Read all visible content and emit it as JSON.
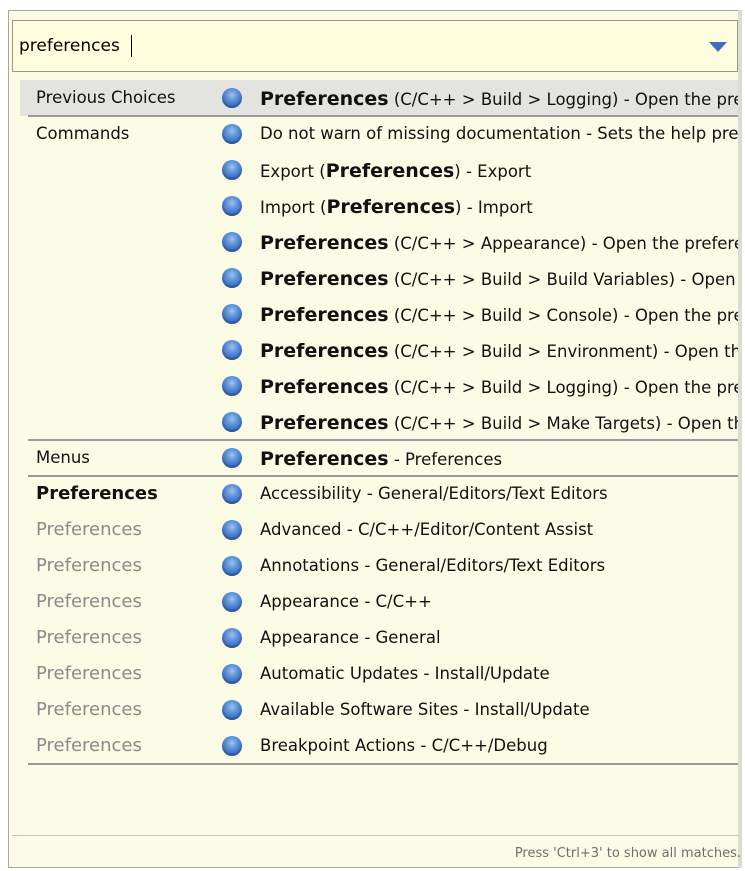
{
  "search": {
    "value": "preferences"
  },
  "rows": [
    {
      "category": "Previous Choices",
      "cat_style": "normal",
      "bold": "Preferences",
      "rest": " (C/C++ > Build > Logging) - Open the preference page",
      "selected": true
    },
    {
      "category": "Commands",
      "cat_style": "normal",
      "pre": "Do not warn of missing documentation - Sets the help preferences"
    },
    {
      "category": "",
      "pre": "Export (",
      "bold": "Preferences",
      "rest": ") - Export"
    },
    {
      "category": "",
      "pre": "Import (",
      "bold": "Preferences",
      "rest": ") - Import"
    },
    {
      "category": "",
      "bold": "Preferences",
      "rest": " (C/C++ > Appearance) - Open the preference page"
    },
    {
      "category": "",
      "bold": "Preferences",
      "rest": " (C/C++ > Build > Build Variables) - Open the preference page"
    },
    {
      "category": "",
      "bold": "Preferences",
      "rest": " (C/C++ > Build > Console) - Open the preference page"
    },
    {
      "category": "",
      "bold": "Preferences",
      "rest": " (C/C++ > Build > Environment) - Open the preference page"
    },
    {
      "category": "",
      "bold": "Preferences",
      "rest": " (C/C++ > Build > Logging) - Open the preference page"
    },
    {
      "category": "",
      "bold": "Preferences",
      "rest": " (C/C++ > Build > Make Targets) - Open the preference page"
    },
    {
      "category": "Menus",
      "cat_style": "normal",
      "bold": "Preferences",
      "rest": " - Preferences"
    },
    {
      "category": "Preferences",
      "cat_style": "bold",
      "pre": "Accessibility - General/Editors/Text Editors"
    },
    {
      "category": "Preferences",
      "cat_style": "gray",
      "pre": "Advanced - C/C++/Editor/Content Assist"
    },
    {
      "category": "Preferences",
      "cat_style": "gray",
      "pre": "Annotations - General/Editors/Text Editors"
    },
    {
      "category": "Preferences",
      "cat_style": "gray",
      "pre": "Appearance - C/C++"
    },
    {
      "category": "Preferences",
      "cat_style": "gray",
      "pre": "Appearance - General"
    },
    {
      "category": "Preferences",
      "cat_style": "gray",
      "pre": "Automatic Updates - Install/Update"
    },
    {
      "category": "Preferences",
      "cat_style": "gray",
      "pre": "Available Software Sites - Install/Update"
    },
    {
      "category": "Preferences",
      "cat_style": "gray",
      "pre": "Breakpoint Actions - C/C++/Debug"
    }
  ],
  "footer": {
    "hint": "Press 'Ctrl+3' to show all matches."
  },
  "icons": {
    "dropdown": "chevron-down-icon",
    "item": "blue-ball-icon"
  },
  "colors": {
    "accent": "#3d6fbf",
    "background": "#fbfbe6",
    "selection": "#e3e3df"
  }
}
